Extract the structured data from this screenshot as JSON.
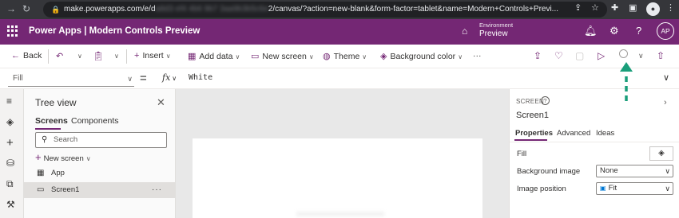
{
  "browser": {
    "url_visible": "make.powerapps.com/e/d",
    "url_obscured": "a8d3 ef4 4b6 9b7 3aa9b3b5c6e",
    "url_rest": "2/canvas/?action=new-blank&form-factor=tablet&name=Modern+Controls+Previ..."
  },
  "header": {
    "app_title": "Power Apps  |  Modern Controls Preview",
    "environment_label": "Environment",
    "environment_value": "Preview",
    "avatar_initials": "AP"
  },
  "commandbar": {
    "back": "Back",
    "insert": "Insert",
    "add_data": "Add data",
    "new_screen": "New screen",
    "theme": "Theme",
    "background_color": "Background color",
    "more": "···"
  },
  "formulabar": {
    "property": "Fill",
    "equals": "=",
    "fx": "fx",
    "formula": "White"
  },
  "tree": {
    "title": "Tree view",
    "tabs": [
      "Screens",
      "Components"
    ],
    "search_placeholder": "Search",
    "new_screen": "New screen",
    "nodes": [
      {
        "label": "App"
      },
      {
        "label": "Screen1"
      }
    ],
    "more": "···"
  },
  "props": {
    "type_label": "SCREEN",
    "help": "?",
    "screen_name": "Screen1",
    "tabs": [
      "Properties",
      "Advanced",
      "Ideas"
    ],
    "rows": [
      {
        "label": "Fill"
      },
      {
        "label": "Background image",
        "value": "None"
      },
      {
        "label": "Image position",
        "value": "Fit"
      }
    ]
  },
  "colors": {
    "brand": "#742774",
    "annotation": "#1a9e7a"
  }
}
